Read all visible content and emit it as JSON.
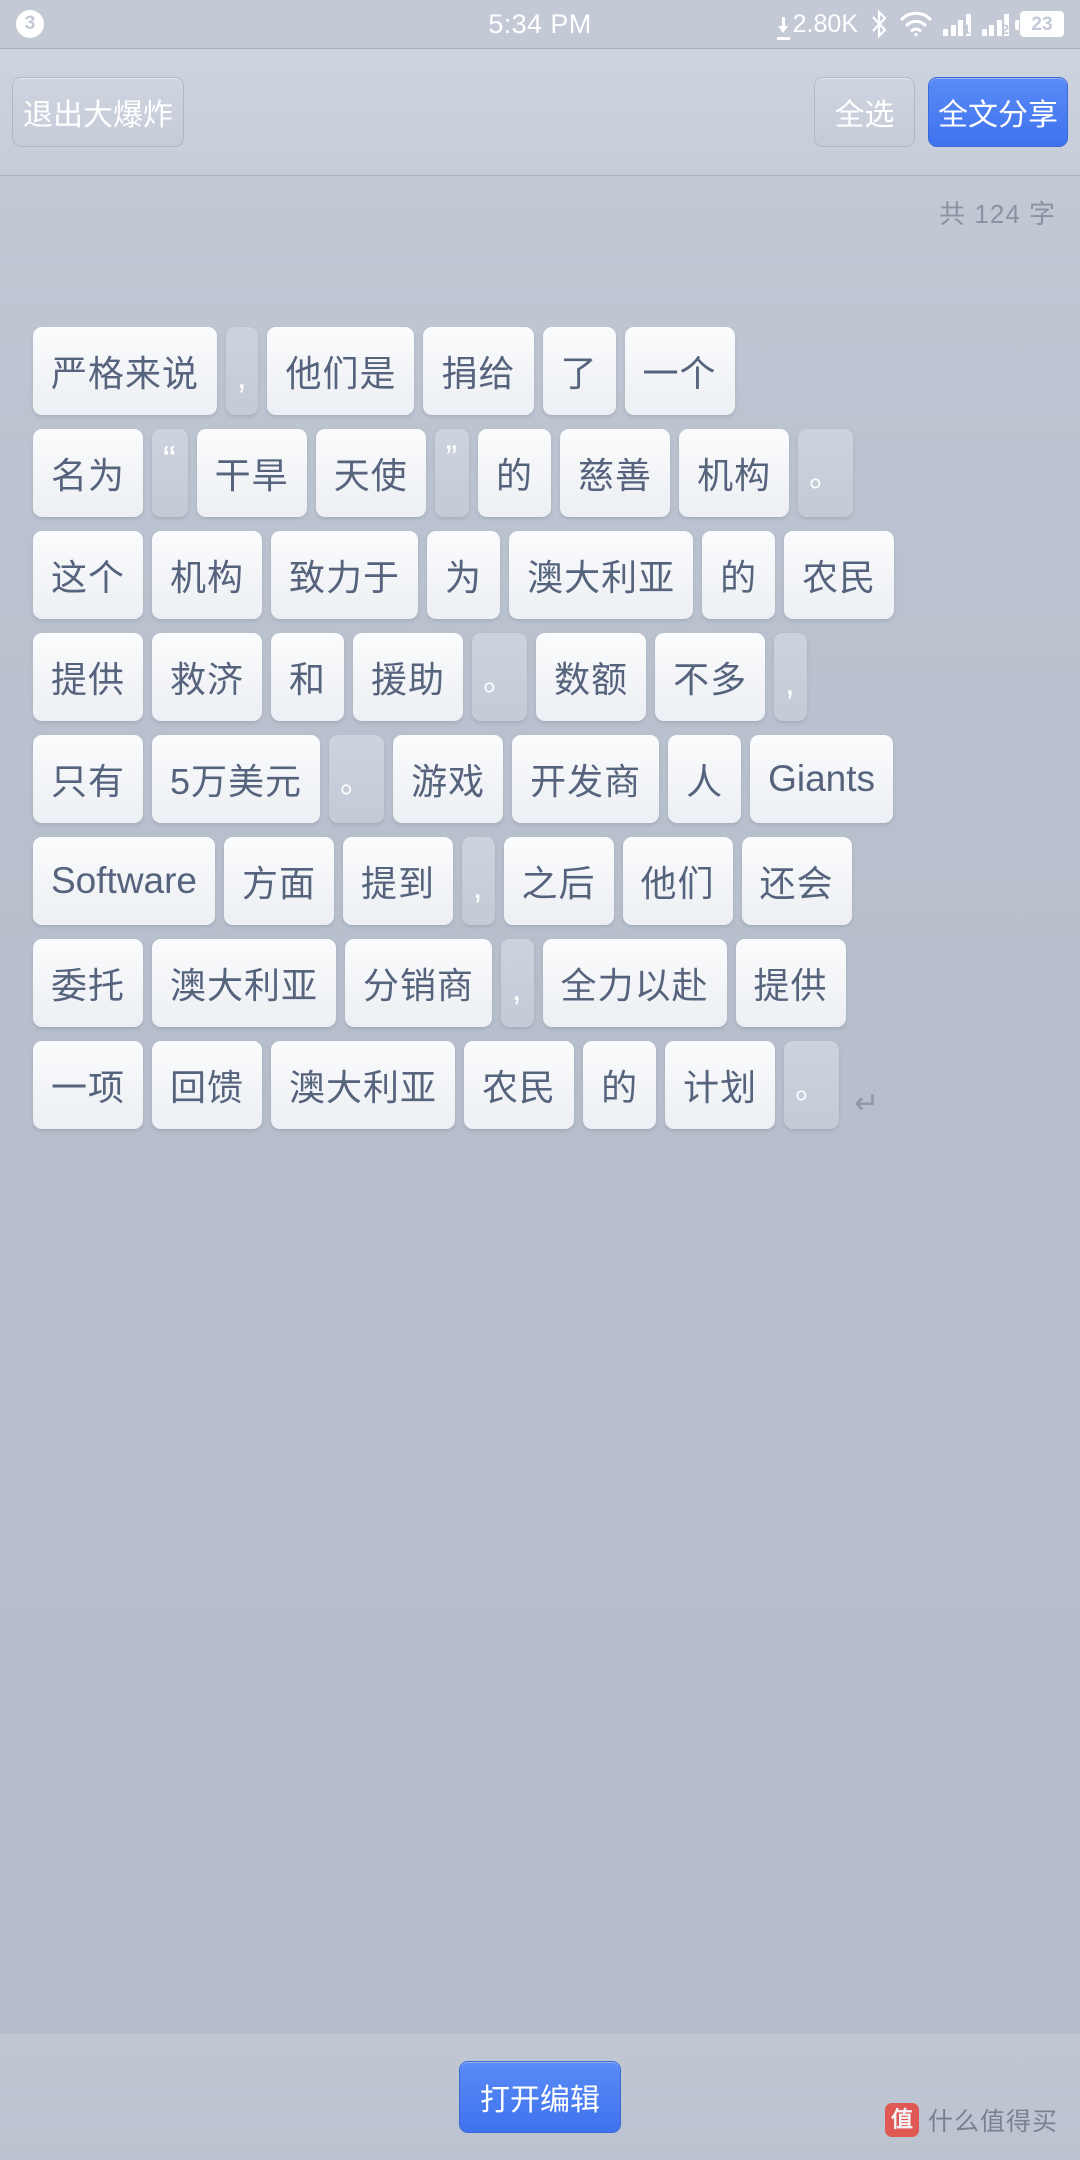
{
  "status_bar": {
    "notification_count": "3",
    "time": "5:34 PM",
    "network_speed": "2.80K",
    "bluetooth_icon": "bluetooth-icon",
    "wifi_icon": "wifi-icon",
    "sim1_label": "1",
    "sim2_label": "2",
    "battery_level": "23"
  },
  "toolbar": {
    "exit_label": "退出大爆炸",
    "select_all_label": "全选",
    "share_all_label": "全文分享",
    "primary_color": "#4a7cf0"
  },
  "content": {
    "word_count_text": "共 124 字",
    "paragraph_end_marker": "↵",
    "rows": [
      [
        {
          "text": "严格来说",
          "type": "word"
        },
        {
          "text": ",",
          "type": "comma"
        },
        {
          "text": "他们是",
          "type": "word"
        },
        {
          "text": "捐给",
          "type": "word"
        },
        {
          "text": "了",
          "type": "word"
        },
        {
          "text": "一个",
          "type": "word"
        }
      ],
      [
        {
          "text": "名为",
          "type": "word"
        },
        {
          "text": "“",
          "type": "quote"
        },
        {
          "text": "干旱",
          "type": "word"
        },
        {
          "text": "天使",
          "type": "word"
        },
        {
          "text": "”",
          "type": "quote-close"
        },
        {
          "text": "的",
          "type": "word"
        },
        {
          "text": "慈善",
          "type": "word"
        },
        {
          "text": "机构",
          "type": "word"
        },
        {
          "text": "。",
          "type": "period"
        }
      ],
      [
        {
          "text": "这个",
          "type": "word"
        },
        {
          "text": "机构",
          "type": "word"
        },
        {
          "text": "致力于",
          "type": "word"
        },
        {
          "text": "为",
          "type": "word"
        },
        {
          "text": "澳大利亚",
          "type": "word"
        },
        {
          "text": "的",
          "type": "word"
        },
        {
          "text": "农民",
          "type": "word"
        }
      ],
      [
        {
          "text": "提供",
          "type": "word"
        },
        {
          "text": "救济",
          "type": "word"
        },
        {
          "text": "和",
          "type": "word"
        },
        {
          "text": "援助",
          "type": "word"
        },
        {
          "text": "。",
          "type": "period"
        },
        {
          "text": "数额",
          "type": "word"
        },
        {
          "text": "不多",
          "type": "word"
        },
        {
          "text": ",",
          "type": "comma"
        }
      ],
      [
        {
          "text": "只有",
          "type": "word"
        },
        {
          "text": "5万美元",
          "type": "word"
        },
        {
          "text": "。",
          "type": "period"
        },
        {
          "text": "游戏",
          "type": "word"
        },
        {
          "text": "开发商",
          "type": "word"
        },
        {
          "text": "人",
          "type": "word"
        },
        {
          "text": "Giants",
          "type": "latin"
        }
      ],
      [
        {
          "text": "Software",
          "type": "latin"
        },
        {
          "text": "方面",
          "type": "word"
        },
        {
          "text": "提到",
          "type": "word"
        },
        {
          "text": ",",
          "type": "comma"
        },
        {
          "text": "之后",
          "type": "word"
        },
        {
          "text": "他们",
          "type": "word"
        },
        {
          "text": "还会",
          "type": "word"
        }
      ],
      [
        {
          "text": "委托",
          "type": "word"
        },
        {
          "text": "澳大利亚",
          "type": "word"
        },
        {
          "text": "分销商",
          "type": "word"
        },
        {
          "text": ",",
          "type": "comma"
        },
        {
          "text": "全力以赴",
          "type": "word"
        },
        {
          "text": "提供",
          "type": "word"
        }
      ],
      [
        {
          "text": "一项",
          "type": "word"
        },
        {
          "text": "回馈",
          "type": "word"
        },
        {
          "text": "澳大利亚",
          "type": "word"
        },
        {
          "text": "农民",
          "type": "word"
        },
        {
          "text": "的",
          "type": "word"
        },
        {
          "text": "计划",
          "type": "word"
        },
        {
          "text": "。",
          "type": "period"
        }
      ]
    ]
  },
  "bottom_bar": {
    "open_editor_label": "打开编辑"
  },
  "watermark": {
    "logo_glyph": "值",
    "text": "什么值得买"
  }
}
